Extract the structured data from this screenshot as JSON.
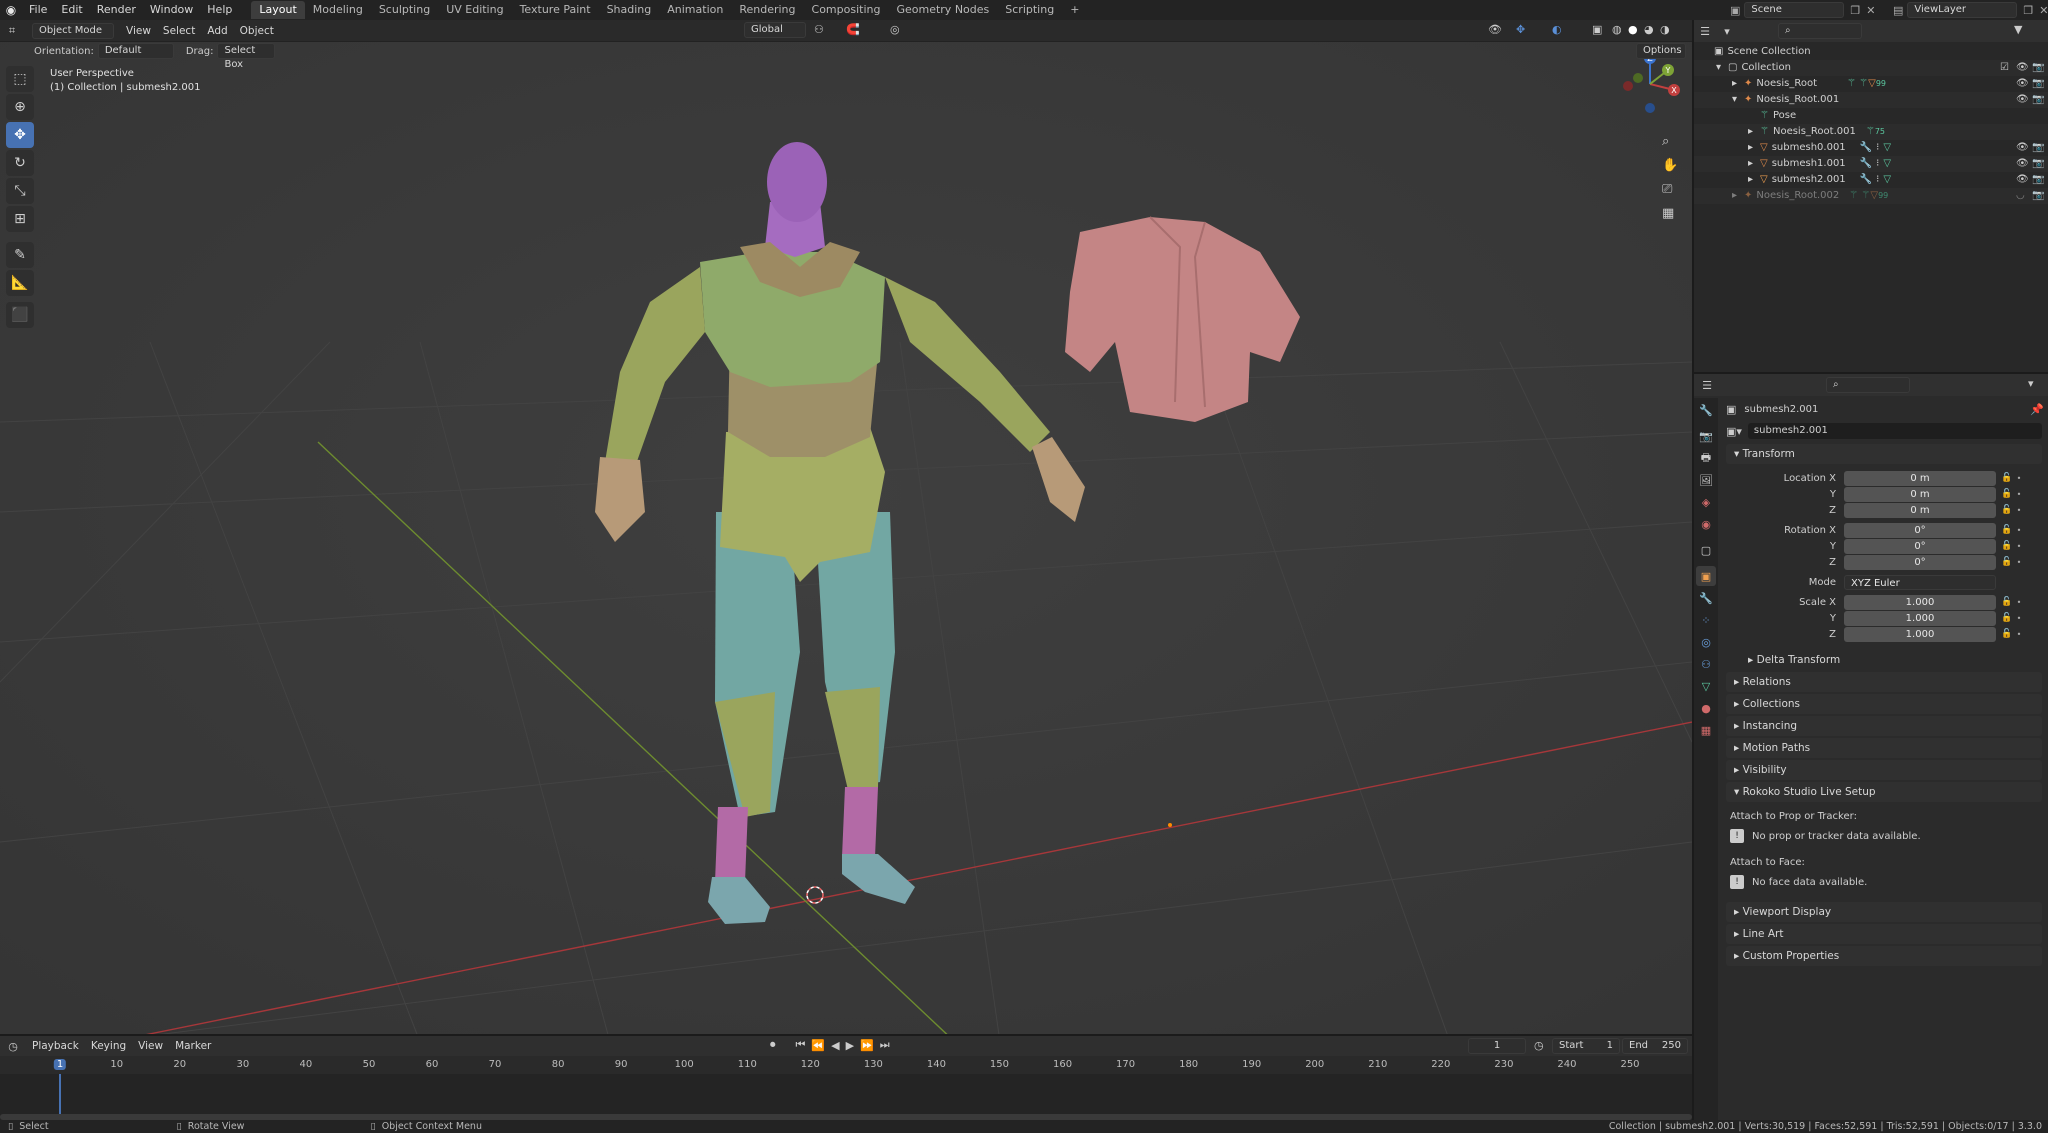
{
  "topbar": {
    "menus": [
      "File",
      "Edit",
      "Render",
      "Window",
      "Help"
    ],
    "workspaces": [
      "Layout",
      "Modeling",
      "Sculpting",
      "UV Editing",
      "Texture Paint",
      "Shading",
      "Animation",
      "Rendering",
      "Compositing",
      "Geometry Nodes",
      "Scripting"
    ],
    "active_workspace": "Layout",
    "scene": "Scene",
    "view_layer": "ViewLayer"
  },
  "viewport_header": {
    "mode": "Object Mode",
    "menus": [
      "View",
      "Select",
      "Add",
      "Object"
    ],
    "orientation_label": "Orientation:",
    "orientation_value": "Default",
    "drag_label": "Drag:",
    "drag_value": "Select Box",
    "transform_orientation": "Global",
    "options": "Options"
  },
  "viewport": {
    "title": "User Perspective",
    "subtitle": "(1) Collection | submesh2.001",
    "gizmo": {
      "x": "X",
      "y": "Y",
      "z": "Z"
    }
  },
  "outliner": {
    "root": "Scene Collection",
    "items": [
      {
        "label": "Collection",
        "indent": 1
      },
      {
        "label": "Noesis_Root",
        "indent": 2
      },
      {
        "label": "Noesis_Root.001",
        "indent": 2
      },
      {
        "label": "Pose",
        "indent": 3
      },
      {
        "label": "Noesis_Root.001",
        "indent": 3
      },
      {
        "label": "submesh0.001",
        "indent": 3
      },
      {
        "label": "submesh1.001",
        "indent": 3
      },
      {
        "label": "submesh2.001",
        "indent": 3
      },
      {
        "label": "Noesis_Root.002",
        "indent": 2
      }
    ],
    "badge_99": "99",
    "badge_75": "75"
  },
  "properties": {
    "object_name": "submesh2.001",
    "object_field": "submesh2.001",
    "transform": {
      "header": "Transform",
      "location_x_label": "Location X",
      "location_x": "0 m",
      "location_y_label": "Y",
      "location_y": "0 m",
      "location_z_label": "Z",
      "location_z": "0 m",
      "rotation_x_label": "Rotation X",
      "rotation_x": "0°",
      "rotation_y_label": "Y",
      "rotation_y": "0°",
      "rotation_z_label": "Z",
      "rotation_z": "0°",
      "mode_label": "Mode",
      "mode": "XYZ Euler",
      "scale_x_label": "Scale X",
      "scale_x": "1.000",
      "scale_y_label": "Y",
      "scale_y": "1.000",
      "scale_z_label": "Z",
      "scale_z": "1.000",
      "delta": "Delta Transform"
    },
    "panels": [
      "Relations",
      "Collections",
      "Instancing",
      "Motion Paths",
      "Visibility"
    ],
    "rokoko": {
      "header": "Rokoko Studio Live Setup",
      "prop_label": "Attach to Prop or Tracker:",
      "prop_msg": "No prop or tracker data available.",
      "face_label": "Attach to Face:",
      "face_msg": "No face data available."
    },
    "panels2": [
      "Viewport Display",
      "Line Art",
      "Custom Properties"
    ]
  },
  "timeline": {
    "menus": [
      "Playback",
      "Keying",
      "View",
      "Marker"
    ],
    "current_frame": "1",
    "start_label": "Start",
    "start": "1",
    "end_label": "End",
    "end": "250",
    "ticks": [
      "1",
      "10",
      "20",
      "30",
      "40",
      "50",
      "60",
      "70",
      "80",
      "90",
      "100",
      "110",
      "120",
      "130",
      "140",
      "150",
      "160",
      "170",
      "180",
      "190",
      "200",
      "210",
      "220",
      "230",
      "240",
      "250"
    ]
  },
  "status": {
    "select": "Select",
    "rotate": "Rotate View",
    "context": "Object Context Menu",
    "stats": "Collection | submesh2.001 | Verts:30,519 | Faces:52,591 | Tris:52,591 | Objects:0/17 | 3.3.0"
  },
  "colors": {
    "accent": "#4772b3",
    "x_axis": "#c2403f",
    "y_axis": "#7ea336",
    "z_axis": "#3b74d1"
  }
}
